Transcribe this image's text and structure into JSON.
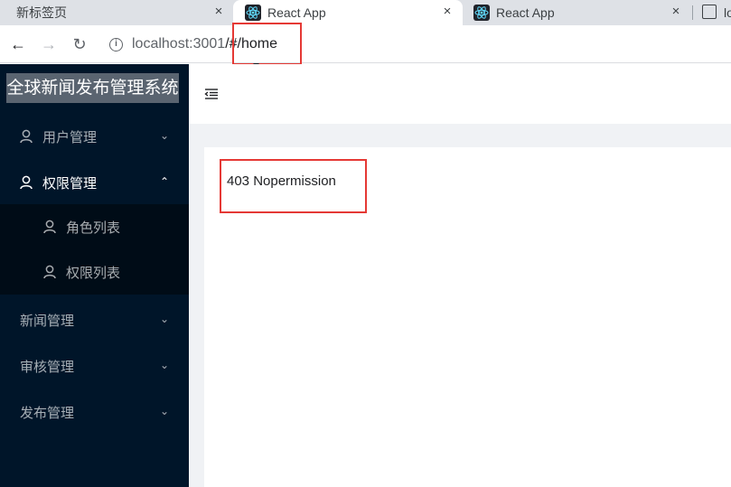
{
  "browser": {
    "tabs": [
      {
        "title": "新标签页",
        "active": false
      },
      {
        "title": "React App",
        "active": true
      },
      {
        "title": "React App",
        "active": false
      },
      {
        "title": "lo",
        "active": false
      }
    ],
    "close_glyph": "×",
    "url_host": "localhost:3001",
    "url_path": "/#/home",
    "icons": [
      "back-arrow-icon",
      "forward-arrow-icon",
      "reload-icon",
      "info-icon",
      "react-logo-icon"
    ]
  },
  "sidebar": {
    "logo": "全球新闻发布管理系统",
    "items": [
      {
        "label": "用户管理",
        "icon": "user-icon",
        "chevron": "⌄"
      },
      {
        "label": "权限管理",
        "icon": "user-icon",
        "chevron": "⌃",
        "open": true
      },
      {
        "label": "新闻管理",
        "chevron": "⌄"
      },
      {
        "label": "审核管理",
        "chevron": "⌄"
      },
      {
        "label": "发布管理",
        "chevron": "⌄"
      }
    ],
    "submenu": [
      {
        "label": "角色列表",
        "icon": "user-icon"
      },
      {
        "label": "权限列表",
        "icon": "user-icon"
      }
    ]
  },
  "main": {
    "message": "403 Nopermission"
  },
  "colors": {
    "sidebar_bg": "#001529",
    "submenu_bg": "#000c17",
    "highlight_box": "#e53935",
    "content_bg": "#f0f2f5"
  }
}
